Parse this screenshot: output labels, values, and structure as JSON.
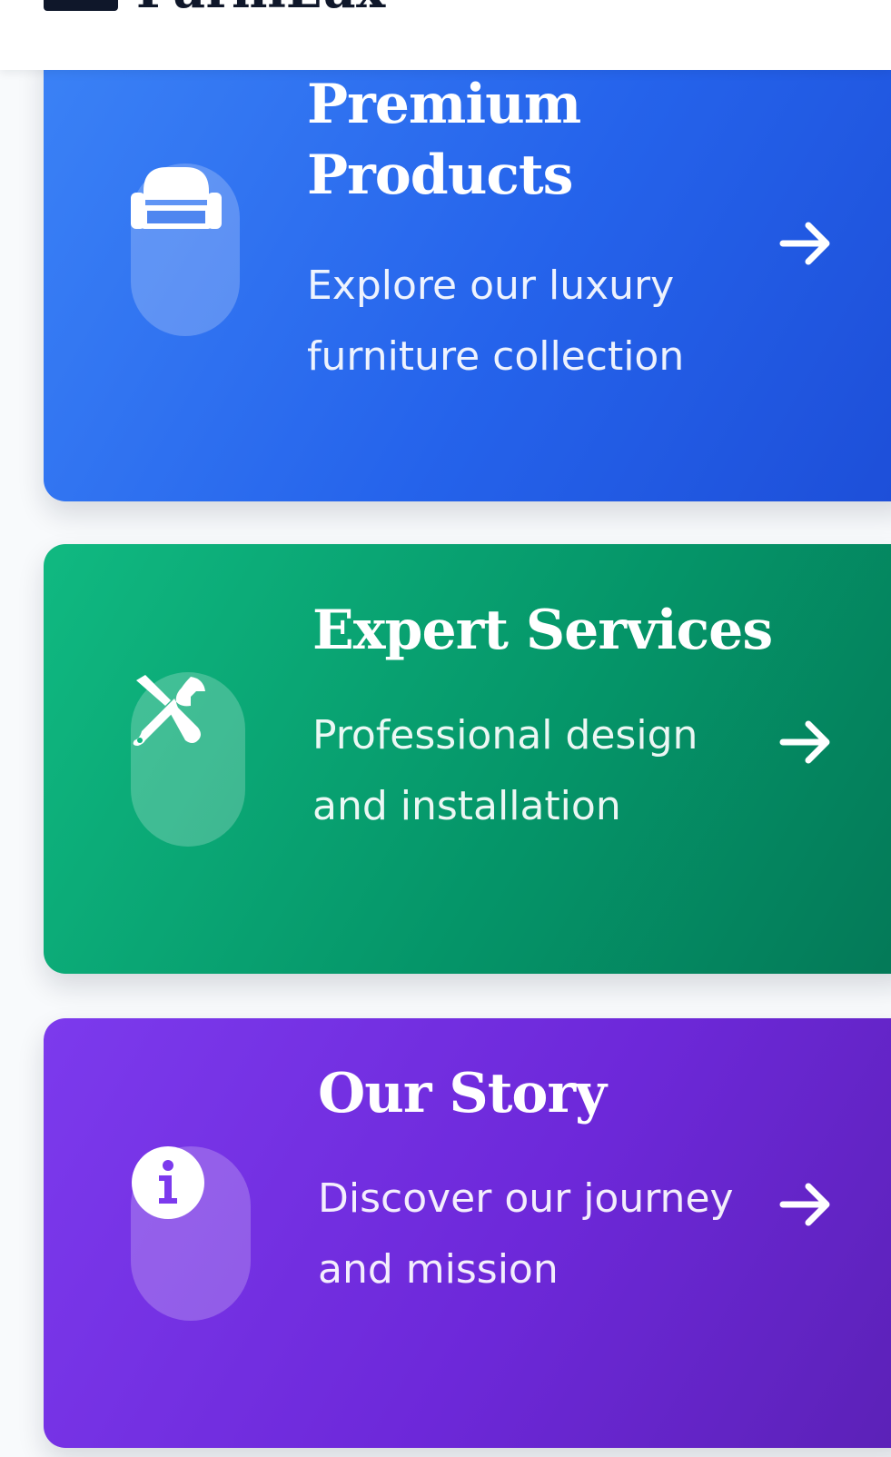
{
  "header": {
    "brand": "FurniLux",
    "logo_icon": "bed-icon"
  },
  "cards": [
    {
      "title_line1": "Premium",
      "title_line2": "Products",
      "desc_line1": "Explore our luxury",
      "desc_line2": "furniture collection",
      "icon": "couch-icon",
      "color": "#2563eb"
    },
    {
      "title": "Expert Services",
      "desc_line1": "Professional design",
      "desc_line2": "and installation",
      "icon": "tools-icon",
      "color": "#059669"
    },
    {
      "title": "Our Story",
      "desc_line1": "Discover our journey",
      "desc_line2": "and mission",
      "icon": "info-icon",
      "color": "#6d28d9"
    }
  ],
  "arrow_icon": "arrow-right-icon"
}
